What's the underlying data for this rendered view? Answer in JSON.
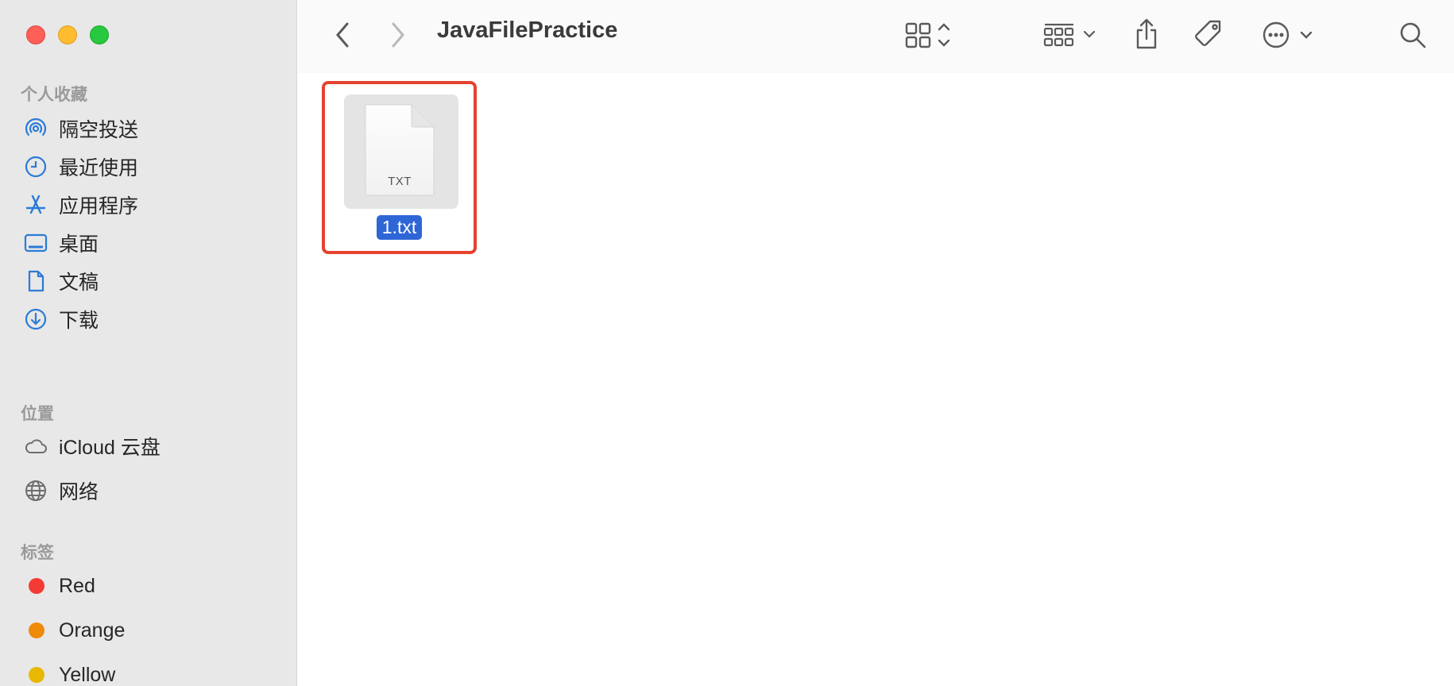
{
  "window": {
    "title": "JavaFilePractice"
  },
  "sidebar": {
    "favorites_title": "个人收藏",
    "favorites": [
      {
        "label": "隔空投送",
        "icon": "airdrop-icon"
      },
      {
        "label": "最近使用",
        "icon": "clock-icon"
      },
      {
        "label": "应用程序",
        "icon": "applications-icon"
      },
      {
        "label": "桌面",
        "icon": "desktop-icon"
      },
      {
        "label": "文稿",
        "icon": "document-icon"
      },
      {
        "label": "下载",
        "icon": "download-icon"
      }
    ],
    "locations_title": "位置",
    "locations": [
      {
        "label": "iCloud 云盘",
        "icon": "cloud-icon"
      },
      {
        "label": "网络",
        "icon": "globe-icon"
      }
    ],
    "tags_title": "标签",
    "tags": [
      {
        "label": "Red",
        "color": "#f33b34"
      },
      {
        "label": "Orange",
        "color": "#f08a0a"
      },
      {
        "label": "Yellow",
        "color": "#e8b800"
      }
    ]
  },
  "toolbar": {
    "icons": [
      "back-icon",
      "forward-icon",
      "view-grid-icon",
      "group-icon",
      "share-icon",
      "tag-icon",
      "more-icon",
      "search-icon"
    ]
  },
  "content": {
    "files": [
      {
        "name": "1.txt",
        "type_label": "TXT",
        "selected": true
      }
    ]
  },
  "colors": {
    "accent": "#2f66d6",
    "sidebar_icon": "#2a7bd8",
    "highlight_border": "#e5432f"
  }
}
